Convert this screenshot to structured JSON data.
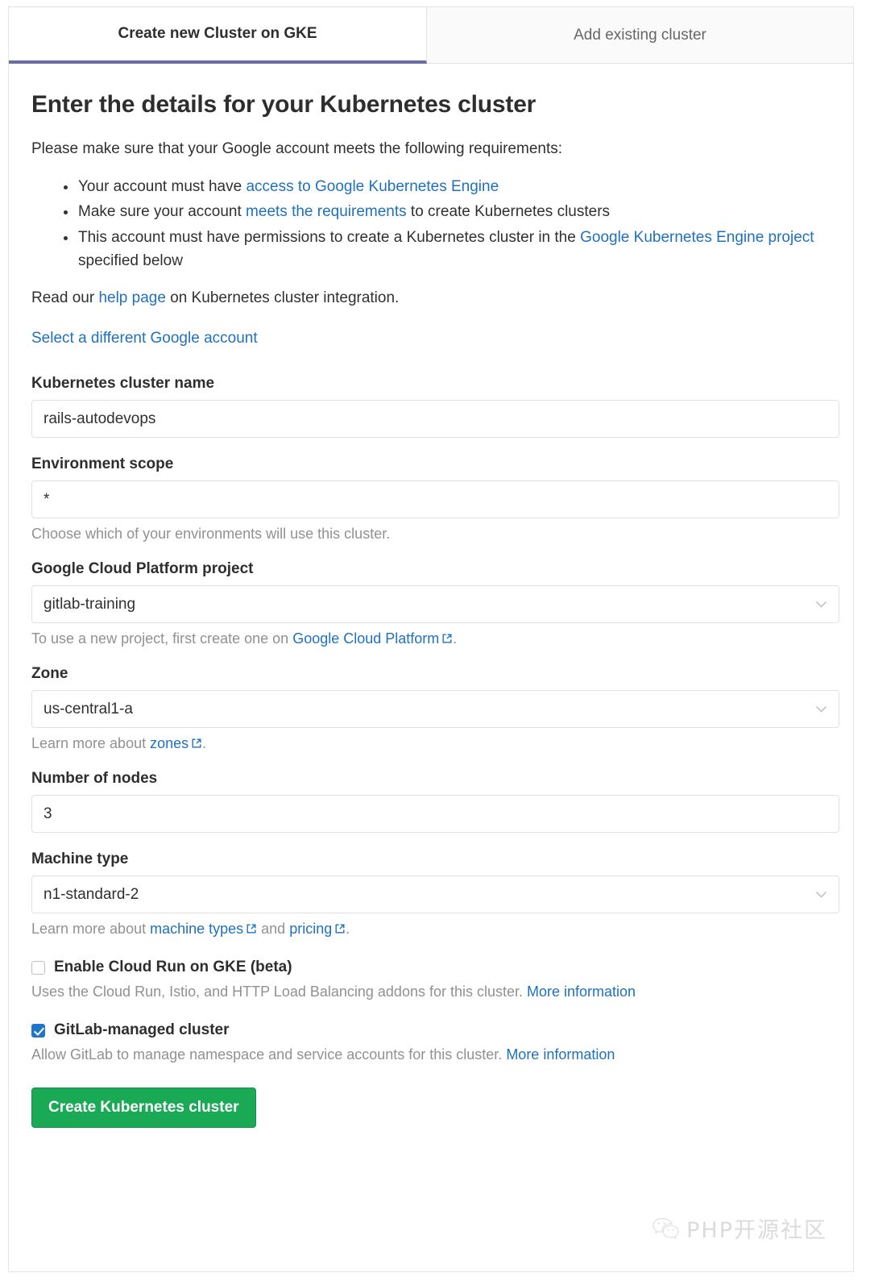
{
  "tabs": [
    {
      "label": "Create new Cluster on GKE",
      "active": true
    },
    {
      "label": "Add existing cluster",
      "active": false
    }
  ],
  "page": {
    "title": "Enter the details for your Kubernetes cluster",
    "intro": "Please make sure that your Google account meets the following requirements:"
  },
  "requirements": [
    {
      "pre": "Your account must have ",
      "link": "access to Google Kubernetes Engine",
      "post": ""
    },
    {
      "pre": "Make sure your account ",
      "link": "meets the requirements",
      "post": " to create Kubernetes clusters"
    },
    {
      "pre": "This account must have permissions to create a Kubernetes cluster in the ",
      "link": "Google Kubernetes Engine project",
      "post": " specified below"
    }
  ],
  "read_our": {
    "pre": "Read our ",
    "link": "help page",
    "post": " on Kubernetes cluster integration."
  },
  "select_account_link": "Select a different Google account",
  "fields": {
    "cluster_name": {
      "label": "Kubernetes cluster name",
      "value": "rails-autodevops",
      "placeholder": ""
    },
    "environment_scope": {
      "label": "Environment scope",
      "value": "*",
      "placeholder": "",
      "hint": "Choose which of your environments will use this cluster."
    },
    "gcp_project": {
      "label": "Google Cloud Platform project",
      "value": "gitlab-training",
      "options": [
        "gitlab-training"
      ],
      "hint_pre": "To use a new project, first create one on ",
      "hint_link": "Google Cloud Platform",
      "hint_post": "."
    },
    "zone": {
      "label": "Zone",
      "value": "us-central1-a",
      "options": [
        "us-central1-a"
      ],
      "hint_pre": "Learn more about ",
      "hint_link": "zones",
      "hint_post": "."
    },
    "num_nodes": {
      "label": "Number of nodes",
      "value": "3",
      "placeholder": ""
    },
    "machine_type": {
      "label": "Machine type",
      "value": "n1-standard-2",
      "options": [
        "n1-standard-2"
      ],
      "hint_pre": "Learn more about ",
      "hint_link_1": "machine types",
      "hint_mid": " and ",
      "hint_link_2": "pricing",
      "hint_post": "."
    }
  },
  "checkboxes": {
    "cloud_run": {
      "label": "Enable Cloud Run on GKE (beta)",
      "checked": false,
      "hint_pre": "Uses the Cloud Run, Istio, and HTTP Load Balancing addons for this cluster. ",
      "hint_link": "More information"
    },
    "gitlab_managed": {
      "label": "GitLab-managed cluster",
      "checked": true,
      "hint_pre": "Allow GitLab to manage namespace and service accounts for this cluster. ",
      "hint_link": "More information"
    }
  },
  "submit_button": "Create Kubernetes cluster",
  "watermark": {
    "text": "PHP开源社区",
    "icon": "wechat-icon"
  },
  "colors": {
    "link": "#1f71bd",
    "accent_purple": "#6b6ba8",
    "primary_green": "#1aaa55",
    "checkbox_blue": "#1f75cb",
    "hint_gray": "#919191"
  }
}
